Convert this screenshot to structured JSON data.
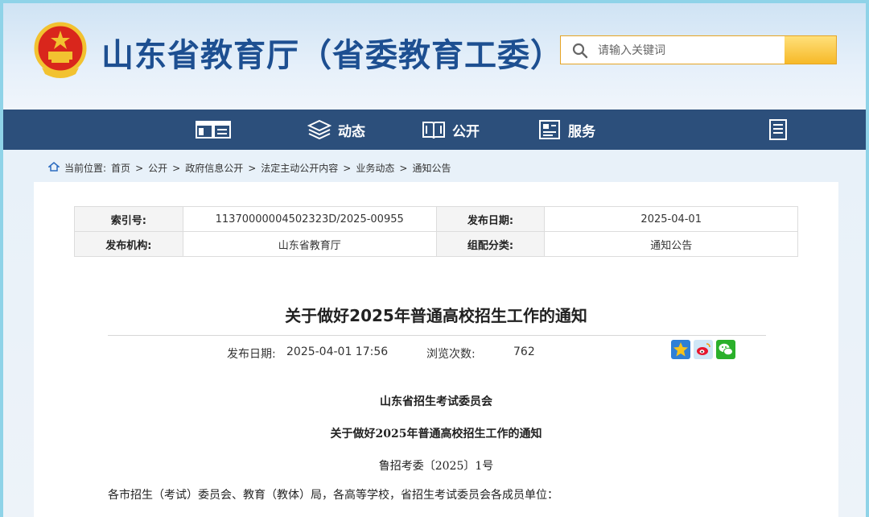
{
  "header": {
    "site_title": "山东省教育厅（省委教育工委）",
    "search": {
      "placeholder": "请输入关键词"
    }
  },
  "nav": {
    "items": [
      {
        "label": "",
        "icon": "homepage-icon"
      },
      {
        "label": "动态",
        "icon": "stack-icon"
      },
      {
        "label": "公开",
        "icon": "book-icon"
      },
      {
        "label": "服务",
        "icon": "service-icon"
      },
      {
        "label": "",
        "icon": "document-icon"
      }
    ]
  },
  "breadcrumb": {
    "prefix": "当前位置:",
    "items": [
      "首页",
      "公开",
      "政府信息公开",
      "法定主动公开内容",
      "业务动态",
      "通知公告"
    ],
    "separator": ">"
  },
  "meta": {
    "index_label": "索引号:",
    "index_value": "11370000004502323D/2025-00955",
    "publish_date_label": "发布日期:",
    "publish_date_value": "2025-04-01",
    "org_label": "发布机构:",
    "org_value": "山东省教育厅",
    "category_label": "组配分类:",
    "category_value": "通知公告"
  },
  "article": {
    "title": "关于做好2025年普通高校招生工作的通知",
    "date_label": "发布日期:",
    "date_value": "2025-04-01 17:56",
    "views_label": "浏览次数:",
    "views_value": "762",
    "issuer": "山东省招生考试委员会",
    "doc_title": "关于做好2025年普通高校招生工作的通知",
    "doc_number": "鲁招考委〔2025〕1号",
    "salutation": "各市招生（考试）委员会、教育（教体）局，各高等学校，省招生考试委员会各成员单位："
  },
  "colors": {
    "brand_blue": "#1d4f91",
    "nav_bg": "#2c4f7b",
    "search_accent": "#f6b928"
  }
}
